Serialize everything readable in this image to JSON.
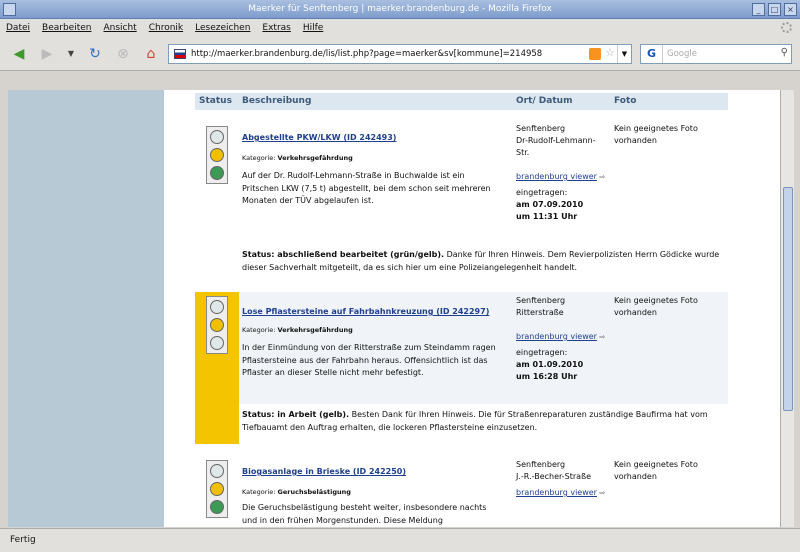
{
  "window": {
    "title": "Maerker für Senftenberg | maerker.brandenburg.de - Mozilla Firefox"
  },
  "menu": [
    "Datei",
    "Bearbeiten",
    "Ansicht",
    "Chronik",
    "Lesezeichen",
    "Extras",
    "Hilfe"
  ],
  "url": "http://maerker.brandenburg.de/lis/list.php?page=maerker&sv[kommune]=214958",
  "search_placeholder": "Google",
  "table_header": {
    "status": "Status",
    "beschreibung": "Beschreibung",
    "ort": "Ort/ Datum",
    "foto": "Foto"
  },
  "entries": [
    {
      "light": "green",
      "title": "Abgestellte PKW/LKW (ID 242493)",
      "kategorie_label": "Kategorie:",
      "kategorie": "Verkehrsgefährdung",
      "description": "Auf der Dr. Rudolf-Lehmann-Straße in Buchwalde ist ein Pritschen LKW (7,5 t) abgestellt, bei dem schon seit mehreren Monaten der TÜV abgelaufen ist.",
      "ort_line1": "Senftenberg",
      "ort_line2": "Dr-Rudolf-Lehmann-Str.",
      "viewer_link": "brandenburg viewer",
      "eingetragen": "eingetragen:",
      "date": "am 07.09.2010",
      "time": "um 11:31 Uhr",
      "foto": "Kein geeignetes Foto vorhanden",
      "status_label": "Status: abschließend bearbeitet (grün/gelb).",
      "status_text": " Danke für Ihren Hinweis. Dem Revierpolizisten Herrn Gödicke wurde dieser Sachverhalt mitgeteilt, da es sich hier um eine Polizeiangelegenheit handelt."
    },
    {
      "light": "yellow",
      "title": "Lose Pflastersteine auf Fahrbahnkreuzung (ID 242297)",
      "kategorie_label": "Kategorie:",
      "kategorie": "Verkehrsgefährdung",
      "description": "In der Einmündung von der Ritterstraße zum Steindamm ragen Pflastersteine aus der Fahrbahn heraus. Offensichtlich ist das Pflaster an dieser Stelle nicht mehr befestigt.",
      "ort_line1": "Senftenberg",
      "ort_line2": "Ritterstraße",
      "viewer_link": "brandenburg viewer",
      "eingetragen": "eingetragen:",
      "date": "am 01.09.2010",
      "time": "um 16:28 Uhr",
      "foto": "Kein geeignetes Foto vorhanden",
      "status_label": "Status: in Arbeit (gelb).",
      "status_text": " Besten Dank für Ihren Hinweis. Die für Straßenreparaturen zuständige Baufirma hat vom Tiefbauamt den Auftrag erhalten, die lockeren Pflastersteine einzusetzen."
    },
    {
      "light": "green",
      "title": "Biogasanlage in Brieske (ID 242250)",
      "kategorie_label": "Kategorie:",
      "kategorie": "Geruchsbelästigung",
      "description": "Die Geruchsbelästigung besteht weiter, insbesondere nachts und in den frühen Morgenstunden. Diese Meldung",
      "ort_line1": "Senftenberg",
      "ort_line2": "J.-R.-Becher-Straße",
      "viewer_link": "brandenburg viewer",
      "foto": "Kein geeignetes Foto vorhanden"
    }
  ],
  "statusbar": "Fertig",
  "colors": {
    "yellow_highlight": "#f5c400",
    "link": "#1f3f8f",
    "header_bg": "#dde7f0",
    "sidebar": "#b8c9d6"
  }
}
